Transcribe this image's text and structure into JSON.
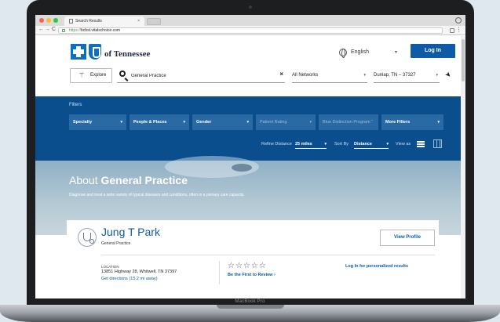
{
  "device": {
    "label": "MacBook Pro"
  },
  "browser": {
    "tab_title": "Search Results",
    "tab_close": "×",
    "url_protocol": "https://",
    "url_host": "bcbst.vitalschoice.com",
    "nav_back": "←",
    "nav_forward": "→",
    "nav_reload": "C",
    "menu": "⋮"
  },
  "header": {
    "logo_text": "of Tennessee",
    "language": "English",
    "login_label": "Log In"
  },
  "search": {
    "explore_label": "Explore",
    "query": "General Practice",
    "clear": "×",
    "network": "All Networks",
    "location": "Dunlap, TN – 37327"
  },
  "filters": {
    "title": "Filters",
    "items": [
      {
        "label": "Specialty"
      },
      {
        "label": "People & Places"
      },
      {
        "label": "Gender"
      },
      {
        "label": "Patient Rating"
      },
      {
        "label": "Blue Distinction Program ˜"
      },
      {
        "label": "More Filters"
      }
    ],
    "refine_label": "Refine Distance",
    "refine_value": "25 miles",
    "sort_label": "Sort By",
    "sort_value": "Distance",
    "view_label": "View as"
  },
  "hero": {
    "title_prefix": "About ",
    "title_bold": "General Practice",
    "description": "Diagnose and treat a wide variety of typical diseases and conditions, often in a primary care capacity."
  },
  "result": {
    "name": "Jung T Park",
    "specialty": "General Practice",
    "view_profile": "View Profile",
    "location_label": "LOCATION",
    "address": "13851 Highway 28, Whitwell, TN 37397",
    "directions": "Get directions (15.2 mi away)",
    "stars": "☆☆☆☆☆",
    "review_link": "Be the First to Review  ›",
    "personalize_link": "Log In for personalized results"
  },
  "colors": {
    "brand_blue": "#0c6fbf",
    "filters_bg": "#0a4e8d",
    "link_blue": "#0c5aa6"
  }
}
